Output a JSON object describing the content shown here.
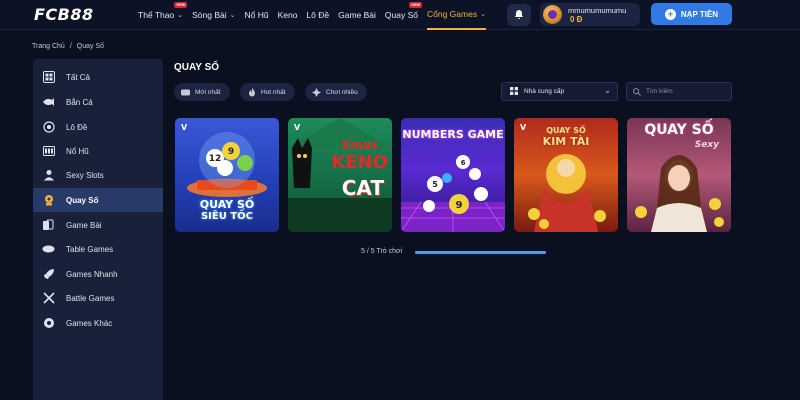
{
  "header": {
    "logo": "FCB88",
    "nav": [
      {
        "label": "Thể Thao",
        "dropdown": true,
        "badge": "new",
        "active": false
      },
      {
        "label": "Sòng Bài",
        "dropdown": true,
        "badge": null,
        "active": false
      },
      {
        "label": "Nổ Hũ",
        "dropdown": false,
        "badge": null,
        "active": false
      },
      {
        "label": "Keno",
        "dropdown": false,
        "badge": null,
        "active": false
      },
      {
        "label": "Lô Đề",
        "dropdown": false,
        "badge": null,
        "active": false
      },
      {
        "label": "Game Bài",
        "dropdown": false,
        "badge": null,
        "active": false
      },
      {
        "label": "Quay Số",
        "dropdown": false,
        "badge": "new",
        "active": false
      },
      {
        "label": "Cổng Games",
        "dropdown": true,
        "badge": null,
        "active": true
      }
    ],
    "badge_text": "new",
    "username": "mmumumumumu",
    "balance": "0 Đ",
    "deposit_label": "NẠP TIỀN",
    "accent_color": "#f3b13a",
    "deposit_color": "#2f7ae5"
  },
  "breadcrumb": {
    "home": "Trang Chủ",
    "separator": "/",
    "current": "Quay Số"
  },
  "sidebar": {
    "items": [
      {
        "label": "Tất Cả",
        "icon": "grid-icon",
        "active": false
      },
      {
        "label": "Bắn Cá",
        "icon": "fish-icon",
        "active": false
      },
      {
        "label": "Lô Đề",
        "icon": "lottery-ball-icon",
        "active": false
      },
      {
        "label": "Nổ Hũ",
        "icon": "slot-icon",
        "active": false
      },
      {
        "label": "Sexy Slots",
        "icon": "person-icon",
        "active": false
      },
      {
        "label": "Quay Số",
        "icon": "lottery-icon",
        "active": true
      },
      {
        "label": "Game Bài",
        "icon": "cards-icon",
        "active": false
      },
      {
        "label": "Table Games",
        "icon": "table-icon",
        "active": false
      },
      {
        "label": "Games Nhanh",
        "icon": "rocket-icon",
        "active": false
      },
      {
        "label": "Battle Games",
        "icon": "swords-icon",
        "active": false
      },
      {
        "label": "Games Khác",
        "icon": "more-games-icon",
        "active": false
      }
    ]
  },
  "main": {
    "title": "QUAY SỐ",
    "filters": [
      {
        "label": "Mới nhất",
        "icon": "new-icon"
      },
      {
        "label": "Hot nhất",
        "icon": "flame-icon"
      },
      {
        "label": "Chơi nhiều",
        "icon": "gamepad-icon"
      }
    ],
    "provider_label": "Nhà cung cấp",
    "search_placeholder": "Tìm kiếm",
    "games": [
      {
        "title_line1": "QUAY SỐ",
        "title_line2": "SIÊU TỐC",
        "provider_mark": "V"
      },
      {
        "title_line1": "Xmas",
        "title_line2": "KENO",
        "title_line3": "CAT",
        "provider_mark": "V"
      },
      {
        "title_line1": "NUMBERS GAME",
        "provider_mark": ""
      },
      {
        "title_line1": "QUAY SỐ",
        "title_line2": "KIM TÀI",
        "provider_mark": "V"
      },
      {
        "title_line1": "QUAY SỐ",
        "title_line2": "Sexy",
        "provider_mark": ""
      }
    ],
    "pagination_text": "5 / 5 Trò chơi",
    "progress": 1.0
  }
}
